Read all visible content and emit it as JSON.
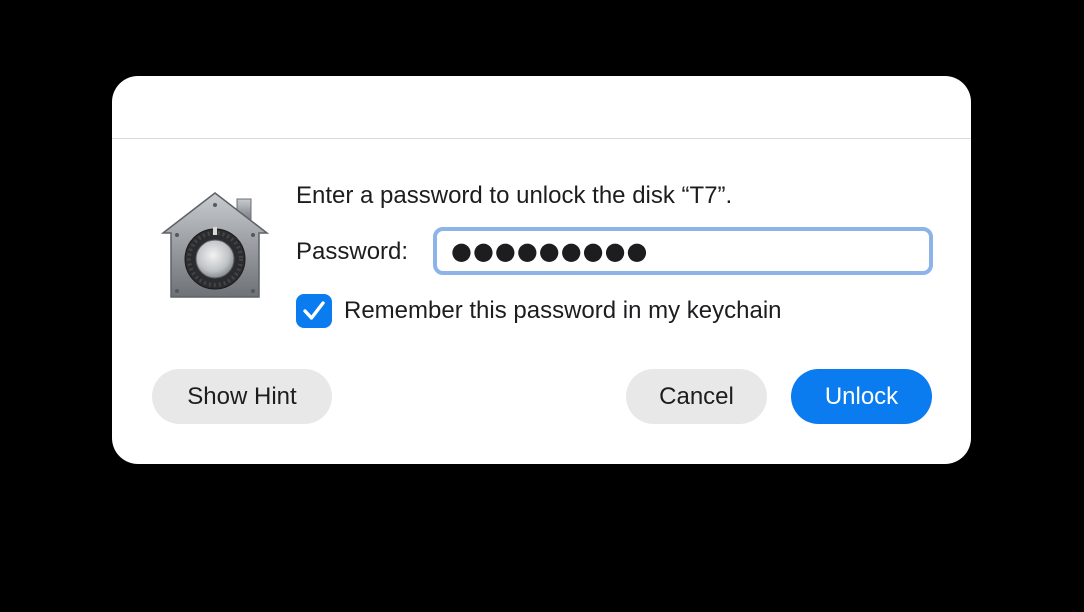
{
  "dialog": {
    "message": "Enter a password to unlock the disk “T7”.",
    "password_label": "Password:",
    "password_value": "●●●●●●●●●",
    "remember_label": "Remember this password in my keychain",
    "remember_checked": true,
    "icon": "filevault-lock-icon"
  },
  "buttons": {
    "show_hint": "Show Hint",
    "cancel": "Cancel",
    "unlock": "Unlock"
  },
  "colors": {
    "accent": "#0a7cf0",
    "focus_ring": "#8db3e8",
    "secondary_button": "#e8e8e8",
    "background": "#000000"
  }
}
